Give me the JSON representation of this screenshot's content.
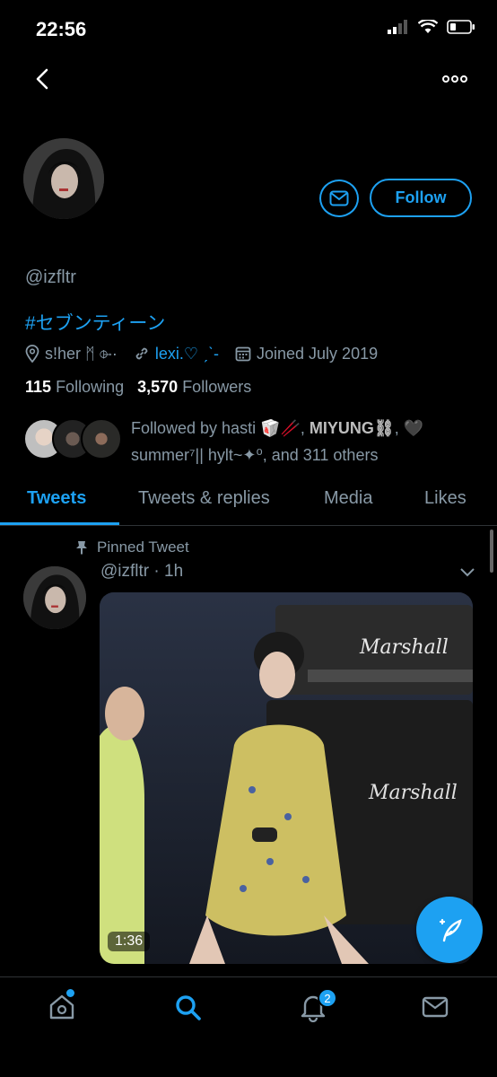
{
  "status_bar": {
    "time": "22:56"
  },
  "profile": {
    "handle": "@izfltr",
    "bio": "#セブンティーン",
    "location": "s!her ᛗ ⌱·",
    "website": "lexi.♡ ˏˋ-",
    "joined": "Joined July 2019",
    "following_count": "115",
    "following_label": "Following",
    "followers_count": "3,570",
    "followers_label": "Followers",
    "follow_button_label": "Follow",
    "followed_by_prefix": "Followed by hasti 🥡🥢, ",
    "followed_by_bold": "MIYUNG⛓",
    "followed_by_mid": ", 🖤",
    "followed_by_rest": "summer⁷|| hylt~✦⁰, and 311 others"
  },
  "tabs": [
    {
      "label": "Tweets"
    },
    {
      "label": "Tweets & replies"
    },
    {
      "label": "Media"
    },
    {
      "label": "Likes"
    }
  ],
  "tweet": {
    "pinned_label": "Pinned Tweet",
    "handle_time": "@izfltr · 1h",
    "video_duration": "1:36"
  },
  "bottom_nav": {
    "notifications_badge": "2",
    "icons": [
      "home-icon",
      "search-icon",
      "bell-icon",
      "mail-icon"
    ]
  },
  "colors": {
    "accent": "#1da1f2",
    "background": "#000000",
    "muted": "#8899a6"
  }
}
